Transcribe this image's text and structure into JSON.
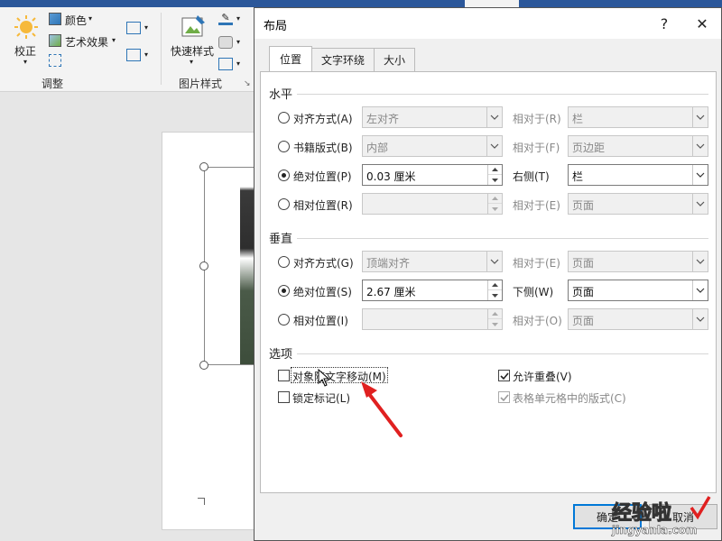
{
  "ribbon": {
    "corrections_label": "校正",
    "color_label": "颜色",
    "artistic_label": "艺术效果",
    "quick_styles_label": "快速样式",
    "adjust_group_label": "调整",
    "picture_styles_group_label": "图片样式"
  },
  "dialog": {
    "title": "布局",
    "help_label": "?",
    "close_label": "✕",
    "tabs": [
      "位置",
      "文字环绕",
      "大小"
    ],
    "active_tab": "位置",
    "horizontal": {
      "label": "水平",
      "rows": [
        {
          "option": "对齐方式(A)",
          "value": "左对齐",
          "relative_label": "相对于(R)",
          "relative_value": "栏",
          "selected": false
        },
        {
          "option": "书籍版式(B)",
          "value": "内部",
          "relative_label": "相对于(F)",
          "relative_value": "页边距",
          "selected": false
        },
        {
          "option": "绝对位置(P)",
          "value": "0.03 厘米",
          "relative_label": "右侧(T)",
          "relative_value": "栏",
          "selected": true
        },
        {
          "option": "相对位置(R)",
          "value": "",
          "relative_label": "相对于(E)",
          "relative_value": "页面",
          "selected": false
        }
      ]
    },
    "vertical": {
      "label": "垂直",
      "rows": [
        {
          "option": "对齐方式(G)",
          "value": "顶端对齐",
          "relative_label": "相对于(E)",
          "relative_value": "页面",
          "selected": false
        },
        {
          "option": "绝对位置(S)",
          "value": "2.67 厘米",
          "relative_label": "下侧(W)",
          "relative_value": "页面",
          "selected": true
        },
        {
          "option": "相对位置(I)",
          "value": "",
          "relative_label": "相对于(O)",
          "relative_value": "页面",
          "selected": false
        }
      ]
    },
    "options": {
      "label": "选项",
      "move_with_text": {
        "label": "对象随文字移动(M)",
        "checked": false
      },
      "lock_anchor": {
        "label": "锁定标记(L)",
        "checked": false
      },
      "allow_overlap": {
        "label": "允许重叠(V)",
        "checked": true
      },
      "layout_in_cell": {
        "label": "表格单元格中的版式(C)",
        "checked": true
      }
    },
    "ok_label": "确定",
    "cancel_label": "取消"
  },
  "colors": {
    "accent": "#0078d7",
    "titlebar_blue": "#2b579a",
    "arrow_red": "#e02020"
  },
  "watermark": {
    "text": "经验啦",
    "url": "jingyanla.com"
  }
}
